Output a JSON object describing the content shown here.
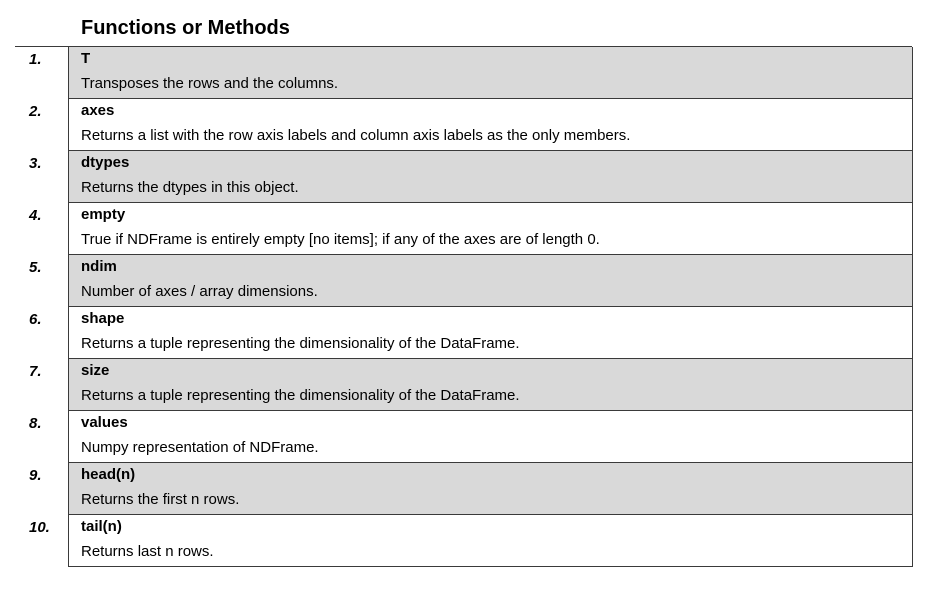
{
  "heading": "Functions or Methods",
  "rows": [
    {
      "num": "1.",
      "name": "T",
      "desc": "Transposes the rows and the columns.",
      "shaded": true
    },
    {
      "num": "2.",
      "name": "axes",
      "desc": "Returns a list with the row axis labels and column axis labels as the only members.",
      "shaded": false
    },
    {
      "num": "3.",
      "name": "dtypes",
      "desc": "Returns the dtypes in this object.",
      "shaded": true
    },
    {
      "num": "4.",
      "name": "empty",
      "desc": "True if NDFrame is entirely empty [no items]; if any of the axes are of length 0.",
      "shaded": false
    },
    {
      "num": "5.",
      "name": "ndim",
      "desc": "Number of axes / array dimensions.",
      "shaded": true
    },
    {
      "num": "6.",
      "name": "shape",
      "desc": "Returns a tuple representing the dimensionality of the DataFrame.",
      "shaded": false
    },
    {
      "num": "7.",
      "name": "size",
      "desc": "Returns a tuple representing the dimensionality of the DataFrame.",
      "shaded": true
    },
    {
      "num": "8.",
      "name": "values",
      "desc": "Numpy representation of NDFrame.",
      "shaded": false
    },
    {
      "num": "9.",
      "name": "head(n)",
      "desc": "Returns the first n rows.",
      "shaded": true
    },
    {
      "num": "10.",
      "name": "tail(n)",
      "desc": "Returns last n rows.",
      "shaded": false
    }
  ],
  "colors": {
    "shade": "#d9d9d9",
    "border": "#3a3a3a"
  }
}
